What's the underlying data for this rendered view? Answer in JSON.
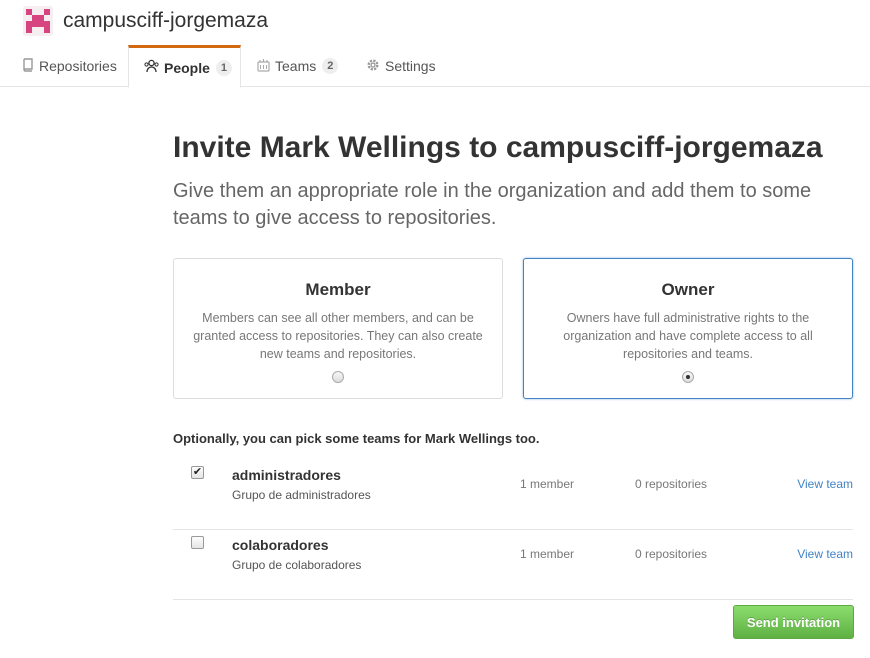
{
  "org": {
    "name": "campusciff-jorgemaza"
  },
  "tabs": [
    {
      "label": "Repositories",
      "icon": "repo-icon"
    },
    {
      "label": "People",
      "icon": "people-icon",
      "count": "1"
    },
    {
      "label": "Teams",
      "icon": "team-icon",
      "count": "2"
    },
    {
      "label": "Settings",
      "icon": "gear-icon"
    }
  ],
  "invite": {
    "title": "Invite Mark Wellings to campusciff-jorgemaza",
    "lead": "Give them an appropriate role in the organization and add them to some teams to give access to repositories."
  },
  "roles": [
    {
      "title": "Member",
      "description": "Members can see all other members, and can be granted access to repositories. They can also create new teams and repositories.",
      "selected": false
    },
    {
      "title": "Owner",
      "description": "Owners have full administrative rights to the organization and have complete access to all repositories and teams.",
      "selected": true
    }
  ],
  "teams_heading": "Optionally, you can pick some teams for Mark Wellings too.",
  "teams": [
    {
      "name": "administradores",
      "description": "Grupo de administradores",
      "members": "1 member",
      "repositories": "0 repositories",
      "link": "View team",
      "checked": true
    },
    {
      "name": "colaboradores",
      "description": "Grupo de colaboradores",
      "members": "1 member",
      "repositories": "0 repositories",
      "link": "View team",
      "checked": false
    }
  ],
  "send_label": "Send invitation",
  "colors": {
    "accent": "#4183c4",
    "tab_active": "#d26911",
    "button": "#60b044",
    "avatar": "#d6457f"
  }
}
